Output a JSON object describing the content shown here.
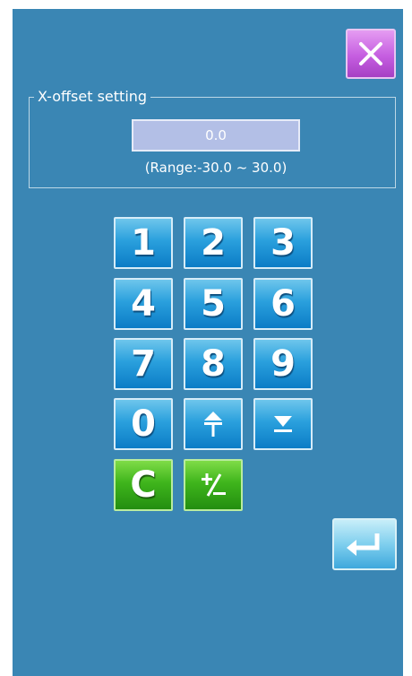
{
  "dialog": {
    "group_title": "X-offset setting",
    "value": "0.0",
    "range": "(Range:-30.0 ~ 30.0)"
  },
  "keypad": {
    "k1": "1",
    "k2": "2",
    "k3": "3",
    "k4": "4",
    "k5": "5",
    "k6": "6",
    "k7": "7",
    "k8": "8",
    "k9": "9",
    "k0": "0",
    "clear": "C"
  },
  "icons": {
    "close": "close-x-icon",
    "up": "up-arrow-icon",
    "down": "down-arrow-icon",
    "sign": "plus-minus-icon",
    "enter": "enter-icon"
  },
  "colors": {
    "background": "#3a86b4",
    "key_blue": "#2aa0dd",
    "key_green": "#3fb51c",
    "close_purple": "#c55ee0",
    "field": "#b3bfe6"
  }
}
